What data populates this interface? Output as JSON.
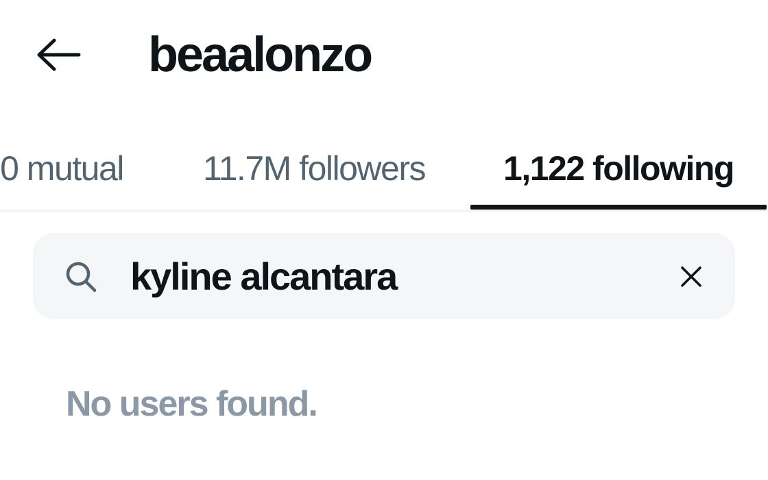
{
  "header": {
    "back_icon": "arrow-left-icon",
    "title": "beaalonzo"
  },
  "tabs": [
    {
      "label": "0 mutual",
      "active": false
    },
    {
      "label": "11.7M followers",
      "active": false
    },
    {
      "label": "1,122 following",
      "active": true
    }
  ],
  "search": {
    "icon": "search-icon",
    "value": "kyline alcantara",
    "clear_icon": "close-icon"
  },
  "results": {
    "empty_message": "No users found."
  },
  "colors": {
    "text_primary": "#0f1419",
    "text_secondary": "#536471",
    "text_muted": "#8b98a5",
    "search_bg": "#f4f6f8"
  }
}
